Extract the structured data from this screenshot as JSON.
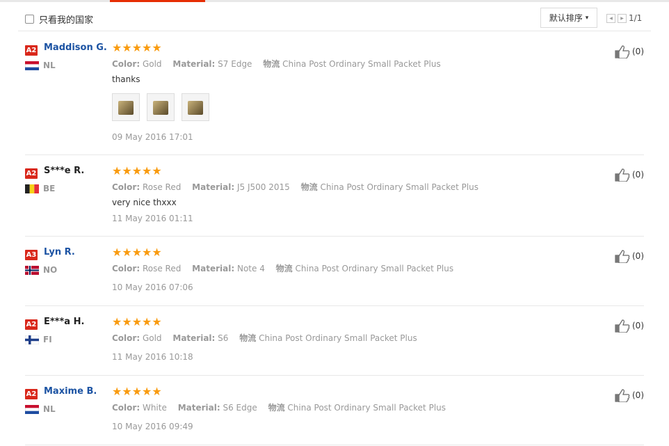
{
  "toolbar": {
    "filter_label": "只看我的国家",
    "sort_label": "默认排序",
    "page_indicator": "1/1"
  },
  "reviews": [
    {
      "level": "A2",
      "name": "Maddison G.",
      "country": "NL",
      "stars": "★★★★★",
      "color_label": "Color:",
      "color": "Gold",
      "material_label": "Material:",
      "material": "S7 Edge",
      "shipping_label": "物流",
      "shipping": "China Post Ordinary Small Packet Plus",
      "content": "thanks",
      "date": "09 May 2016 17:01",
      "helpful": "(0)",
      "photos": 3
    },
    {
      "level": "A2",
      "name": "S***e R.",
      "country": "BE",
      "stars": "★★★★★",
      "color_label": "Color:",
      "color": "Rose Red",
      "material_label": "Material:",
      "material": "J5 J500 2015",
      "shipping_label": "物流",
      "shipping": "China Post Ordinary Small Packet Plus",
      "content": "very nice thxxx",
      "date": "11 May 2016 01:11",
      "helpful": "(0)"
    },
    {
      "level": "A3",
      "name": "Lyn R.",
      "country": "NO",
      "stars": "★★★★★",
      "color_label": "Color:",
      "color": "Rose Red",
      "material_label": "Material:",
      "material": "Note 4",
      "shipping_label": "物流",
      "shipping": "China Post Ordinary Small Packet Plus",
      "date": "10 May 2016 07:06",
      "helpful": "(0)"
    },
    {
      "level": "A2",
      "name": "E***a H.",
      "country": "FI",
      "stars": "★★★★★",
      "color_label": "Color:",
      "color": "Gold",
      "material_label": "Material:",
      "material": "S6",
      "shipping_label": "物流",
      "shipping": "China Post Ordinary Small Packet Plus",
      "date": "11 May 2016 10:18",
      "helpful": "(0)"
    },
    {
      "level": "A2",
      "name": "Maxime B.",
      "country": "NL",
      "stars": "★★★★★",
      "color_label": "Color:",
      "color": "White",
      "material_label": "Material:",
      "material": "S6 Edge",
      "shipping_label": "物流",
      "shipping": "China Post Ordinary Small Packet Plus",
      "date": "10 May 2016 09:49",
      "helpful": "(0)"
    }
  ]
}
